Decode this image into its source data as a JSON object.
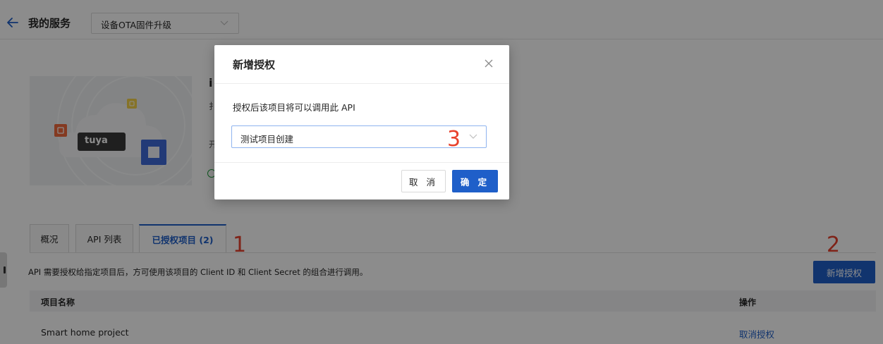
{
  "header": {
    "title": "我的服务",
    "service_select": "设备OTA固件升级"
  },
  "product": {
    "logo_text": "tuya",
    "title_partial": "i",
    "line1_partial": "扌",
    "line2_partial": "开"
  },
  "tabs": [
    {
      "label": "概况",
      "active": false
    },
    {
      "label": "API 列表",
      "active": false
    },
    {
      "label": "已授权项目 (2)",
      "active": true
    }
  ],
  "annotations": {
    "a1": "1",
    "a2": "2",
    "a3": "3"
  },
  "hint": "API 需要授权给指定项目后，方可使用该项目的 Client ID 和 Client Secret 的组合进行调用。",
  "add_button": "新增授权",
  "table": {
    "columns": [
      "项目名称",
      "操作"
    ],
    "rows": [
      {
        "name": "Smart home project",
        "action": "取消授权"
      }
    ]
  },
  "modal": {
    "title": "新增授权",
    "label": "授权后该项目将可以调用此 API",
    "select_value": "测试项目创建",
    "cancel": "取 消",
    "confirm": "确 定"
  },
  "colors": {
    "primary": "#1f5fc9",
    "annotation": "#e8412c",
    "mask": "rgba(0,0,0,0.45)"
  }
}
